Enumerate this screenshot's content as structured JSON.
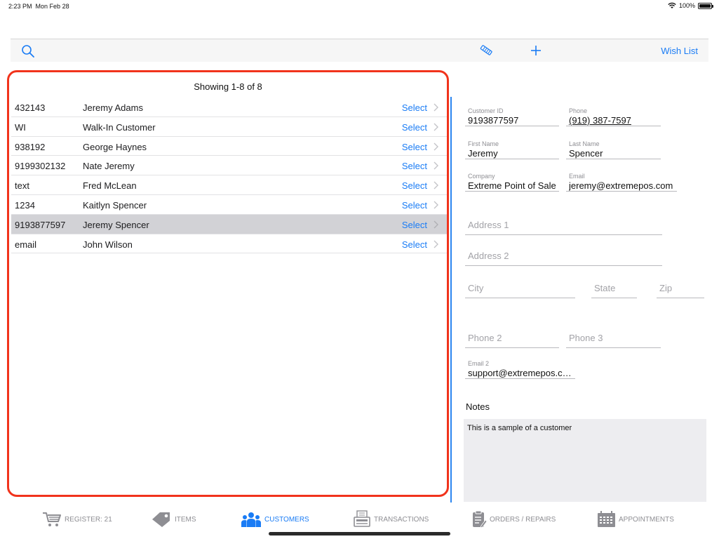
{
  "status_bar": {
    "time": "2:23 PM",
    "date": "Mon Feb 28",
    "battery": "100%"
  },
  "toolbar": {
    "wish_list_label": "Wish List"
  },
  "customer_list": {
    "header": "Showing 1-8 of 8",
    "select_label": "Select",
    "rows": [
      {
        "id": "432143",
        "name": "Jeremy Adams",
        "selected": false
      },
      {
        "id": "WI",
        "name": "Walk-In Customer",
        "selected": false
      },
      {
        "id": "938192",
        "name": "George Haynes",
        "selected": false
      },
      {
        "id": "9199302132",
        "name": "Nate Jeremy",
        "selected": false
      },
      {
        "id": "text",
        "name": "Fred McLean",
        "selected": false
      },
      {
        "id": "1234",
        "name": "Kaitlyn Spencer",
        "selected": false
      },
      {
        "id": "9193877597",
        "name": "Jeremy Spencer",
        "selected": true
      },
      {
        "id": "email",
        "name": "John Wilson",
        "selected": false
      }
    ]
  },
  "detail": {
    "customer_id": {
      "label": "Customer ID",
      "value": "9193877597"
    },
    "phone": {
      "label": "Phone",
      "value": "(919) 387-7597"
    },
    "first_name": {
      "label": "First Name",
      "value": "Jeremy"
    },
    "last_name": {
      "label": "Last Name",
      "value": "Spencer"
    },
    "company": {
      "label": "Company",
      "value": "Extreme Point of Sale"
    },
    "email": {
      "label": "Email",
      "value": "jeremy@extremepos.com"
    },
    "address1": {
      "placeholder": "Address 1"
    },
    "address2": {
      "placeholder": "Address 2"
    },
    "city": {
      "placeholder": "City"
    },
    "state": {
      "placeholder": "State"
    },
    "zip": {
      "placeholder": "Zip"
    },
    "phone2": {
      "placeholder": "Phone 2"
    },
    "phone3": {
      "placeholder": "Phone 3"
    },
    "email2": {
      "label": "Email 2",
      "value": "support@extremepos.com"
    },
    "notes_label": "Notes",
    "notes_value": "This is a sample of a customer"
  },
  "tabs": [
    {
      "label": "REGISTER: 21",
      "icon": "cart-icon",
      "active": false
    },
    {
      "label": "ITEMS",
      "icon": "tag-icon",
      "active": false
    },
    {
      "label": "CUSTOMERS",
      "icon": "people-icon",
      "active": true
    },
    {
      "label": "TRANSACTIONS",
      "icon": "receipt-icon",
      "active": false
    },
    {
      "label": "ORDERS / REPAIRS",
      "icon": "clipboard-icon",
      "active": false
    },
    {
      "label": "APPOINTMENTS",
      "icon": "calendar-icon",
      "active": false
    }
  ],
  "colors": {
    "accent": "#1a7cf5",
    "highlight_border": "#f1331c",
    "selected_row": "#d2d2d6"
  }
}
